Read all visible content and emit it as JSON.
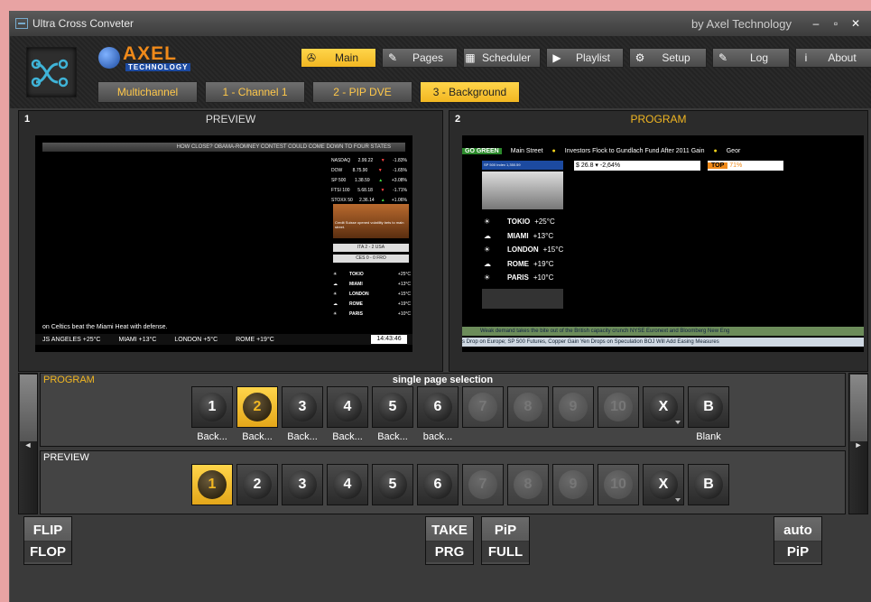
{
  "window": {
    "title": "Ultra Cross Conveter",
    "by": "by Axel Technology",
    "buttons": {
      "minimize": "–",
      "maximize": "▫",
      "close": "✕"
    }
  },
  "brand": {
    "name": "AXEL",
    "sub": "TECHNOLOGY"
  },
  "nav": [
    {
      "label": "Main",
      "icon": "main-icon",
      "glyph": "✇",
      "active": true
    },
    {
      "label": "Pages",
      "icon": "pencil-icon",
      "glyph": "✎",
      "active": false
    },
    {
      "label": "Scheduler",
      "icon": "scheduler-icon",
      "glyph": "▦",
      "active": false
    },
    {
      "label": "Playlist",
      "icon": "play-icon",
      "glyph": "▶",
      "active": false
    },
    {
      "label": "Setup",
      "icon": "gear-icon",
      "glyph": "⚙",
      "active": false
    },
    {
      "label": "Log",
      "icon": "log-icon",
      "glyph": "✎",
      "active": false
    },
    {
      "label": "About",
      "icon": "info-icon",
      "glyph": "i",
      "active": false
    }
  ],
  "subtabs": [
    "Multichannel",
    "1 - Channel 1",
    "2 - PIP DVE",
    "3 - Background"
  ],
  "preview_monitor": {
    "number": "1",
    "title": "PREVIEW",
    "headline": "HOW CLOSE? OBAMA-ROMNEY CONTEST COULD COME DOWN TO FOUR STATES",
    "stocks": [
      {
        "name": "NASDAQ",
        "value": "2.99.22",
        "dir": "dn",
        "chg": "-1.83%"
      },
      {
        "name": "DOW",
        "value": "8.75.90",
        "dir": "dn",
        "chg": "-1.65%"
      },
      {
        "name": "SP 500",
        "value": "1.38.59",
        "dir": "up",
        "chg": "+3.08%"
      },
      {
        "name": "FTSI 100",
        "value": "5.68.18",
        "dir": "dn",
        "chg": "-1.71%"
      },
      {
        "name": "STOXX 50",
        "value": "2.36.14",
        "dir": "up",
        "chg": "+1.06%"
      }
    ],
    "news_caption": "Credit Suisse opened volatility bets to main street.",
    "score1": "ITA 2 - 2 USA",
    "score2": "CES 0 - 0 FRO",
    "cities": [
      {
        "name": "TOKIO",
        "temp": "+25°C",
        "sym": "☀"
      },
      {
        "name": "MIAMI",
        "temp": "+13°C",
        "sym": "☁"
      },
      {
        "name": "LONDON",
        "temp": "+15°C",
        "sym": "☀"
      },
      {
        "name": "ROME",
        "temp": "+19°C",
        "sym": "☁"
      },
      {
        "name": "PARIS",
        "temp": "+10°C",
        "sym": "☀"
      }
    ],
    "crawl1": "on Celtics beat the Miami Heat with defense.",
    "crawl2": [
      "JS ANGELES +25°C",
      "MIAMI +13°C",
      "LONDON +5°C",
      "ROME +19°C"
    ],
    "clock": "14:43:46"
  },
  "program_monitor": {
    "number": "2",
    "title": "PROGRAM",
    "gogreen": "GO GREEN",
    "ticker": [
      "Main Street",
      "Investors Flock to Gundlach Fund After 2011 Gain",
      "Geor"
    ],
    "box1": "SP 500 Index 1,350.59",
    "quote": "$ 26.8 ▾ -2,64%",
    "top": "TOP",
    "top_value": "71%",
    "cities": [
      {
        "name": "TOKIO",
        "temp": "+25°C",
        "sym": "☀"
      },
      {
        "name": "MIAMI",
        "temp": "+13°C",
        "sym": "☁"
      },
      {
        "name": "LONDON",
        "temp": "+15°C",
        "sym": "☀"
      },
      {
        "name": "ROME",
        "temp": "+19°C",
        "sym": "☁"
      },
      {
        "name": "PARIS",
        "temp": "+10°C",
        "sym": "☀"
      }
    ],
    "crawl_a": "Weak demand takes the bite out of the British capacity crunch     NYSE Euronext and Bloomberg New Eng",
    "crawl_b": "s Drop on Europe; SP 500 Futures, Copper Gain     Yen Drops on Speculation BOJ Will Add Easing Measures"
  },
  "program_bar": {
    "label": "PROGRAM",
    "hint": "single page selection",
    "pages": [
      {
        "label": "1",
        "state": "normal",
        "name": "Back..."
      },
      {
        "label": "2",
        "state": "sel",
        "name": "Back..."
      },
      {
        "label": "3",
        "state": "normal",
        "name": "Back..."
      },
      {
        "label": "4",
        "state": "normal",
        "name": "Back..."
      },
      {
        "label": "5",
        "state": "normal",
        "name": "Back..."
      },
      {
        "label": "6",
        "state": "normal",
        "name": "back..."
      },
      {
        "label": "7",
        "state": "dis",
        "name": ""
      },
      {
        "label": "8",
        "state": "dis",
        "name": ""
      },
      {
        "label": "9",
        "state": "dis",
        "name": ""
      },
      {
        "label": "10",
        "state": "dis",
        "name": ""
      },
      {
        "label": "X",
        "state": "x",
        "name": ""
      },
      {
        "label": "B",
        "state": "normal",
        "name": "Blank"
      }
    ]
  },
  "preview_bar": {
    "label": "PREVIEW",
    "pages": [
      {
        "label": "1",
        "state": "sel"
      },
      {
        "label": "2",
        "state": "normal"
      },
      {
        "label": "3",
        "state": "normal"
      },
      {
        "label": "4",
        "state": "normal"
      },
      {
        "label": "5",
        "state": "normal"
      },
      {
        "label": "6",
        "state": "normal"
      },
      {
        "label": "7",
        "state": "dis"
      },
      {
        "label": "8",
        "state": "dis"
      },
      {
        "label": "9",
        "state": "dis"
      },
      {
        "label": "10",
        "state": "dis"
      },
      {
        "label": "X",
        "state": "x"
      },
      {
        "label": "B",
        "state": "normal"
      }
    ]
  },
  "side_arrows": {
    "left": "◄",
    "right": "►"
  },
  "bottom_buttons": {
    "flip": {
      "top": "FLIP",
      "bot": "FLOP"
    },
    "take": {
      "top": "TAKE",
      "bot": "PRG"
    },
    "pip": {
      "top": "PiP",
      "bot": "FULL"
    },
    "auto": {
      "top": "auto",
      "bot": "PiP"
    }
  },
  "colors": {
    "accent": "#f2b722",
    "brand_orange": "#f08a1a",
    "brand_blue": "#1c4aa0"
  }
}
